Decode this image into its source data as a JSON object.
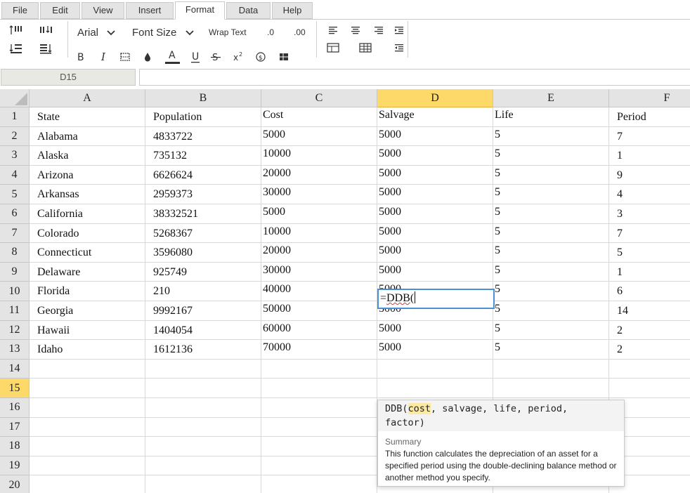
{
  "menu_tabs": [
    "File",
    "Edit",
    "View",
    "Insert",
    "Format",
    "Data",
    "Help"
  ],
  "active_tab": "Format",
  "toolbar": {
    "font_name": "Arial",
    "font_size_label": "Font Size",
    "wrap_text_label": "Wrap Text",
    "decrease_decimal_label": ".0",
    "increase_decimal_label": ".00",
    "font_color": "#333333"
  },
  "name_box": "D15",
  "formula_bar": "",
  "columns": [
    "A",
    "B",
    "C",
    "D",
    "E",
    "F"
  ],
  "selected_column": "D",
  "row_numbers": [
    "1",
    "2",
    "3",
    "4",
    "5",
    "6",
    "7",
    "8",
    "9",
    "10",
    "11",
    "12",
    "13",
    "14",
    "15",
    "16",
    "17",
    "18",
    "19",
    "20"
  ],
  "selected_row": "15",
  "rows": [
    [
      "State",
      "Population",
      "Cost",
      "Salvage",
      "Life",
      "Period"
    ],
    [
      "Alabama",
      "4833722",
      "5000",
      "5000",
      "5",
      "7"
    ],
    [
      "Alaska",
      "735132",
      "10000",
      "5000",
      "5",
      "1"
    ],
    [
      "Arizona",
      "6626624",
      "20000",
      "5000",
      "5",
      "9"
    ],
    [
      "Arkansas",
      "2959373",
      "30000",
      "5000",
      "5",
      "4"
    ],
    [
      "California",
      "38332521",
      "5000",
      "5000",
      "5",
      "3"
    ],
    [
      "Colorado",
      "5268367",
      "10000",
      "5000",
      "5",
      "7"
    ],
    [
      "Connecticut",
      "3596080",
      "20000",
      "5000",
      "5",
      "5"
    ],
    [
      "Delaware",
      "925749",
      "30000",
      "5000",
      "5",
      "1"
    ],
    [
      "Florida",
      "210",
      "40000",
      "5000",
      "5",
      "6"
    ],
    [
      "Georgia",
      "9992167",
      "50000",
      "5000",
      "5",
      "14"
    ],
    [
      "Hawaii",
      "1404054",
      "60000",
      "5000",
      "5",
      "2"
    ],
    [
      "Idaho",
      "1612136",
      "70000",
      "5000",
      "5",
      "2"
    ]
  ],
  "editing_cell": {
    "prefix": "=",
    "function_name": "DDB",
    "suffix": "("
  },
  "tooltip": {
    "sig_start": "DDB(",
    "sig_highlight": "cost",
    "sig_rest": ", salvage, life, period,",
    "sig_line2": "factor)",
    "summary_label": "Summary",
    "description": "This function calculates the depreciation of an asset for a specified period using the double-declining balance method or another method you specify."
  },
  "icons": [
    "insert-row-above-icon",
    "insert-column-icon",
    "insert-row-below-icon",
    "insert-column-right-icon",
    "chevron-down-icon",
    "bold-icon",
    "italic-icon",
    "border-icon",
    "fill-color-icon",
    "font-color-icon",
    "underline-icon",
    "strikethrough-icon",
    "superscript-icon",
    "currency-icon",
    "format-table-icon",
    "align-left-icon",
    "align-center-icon",
    "align-right-icon",
    "indent-icon",
    "merge-cells-icon",
    "unmerge-cells-icon",
    "outdent-icon"
  ]
}
